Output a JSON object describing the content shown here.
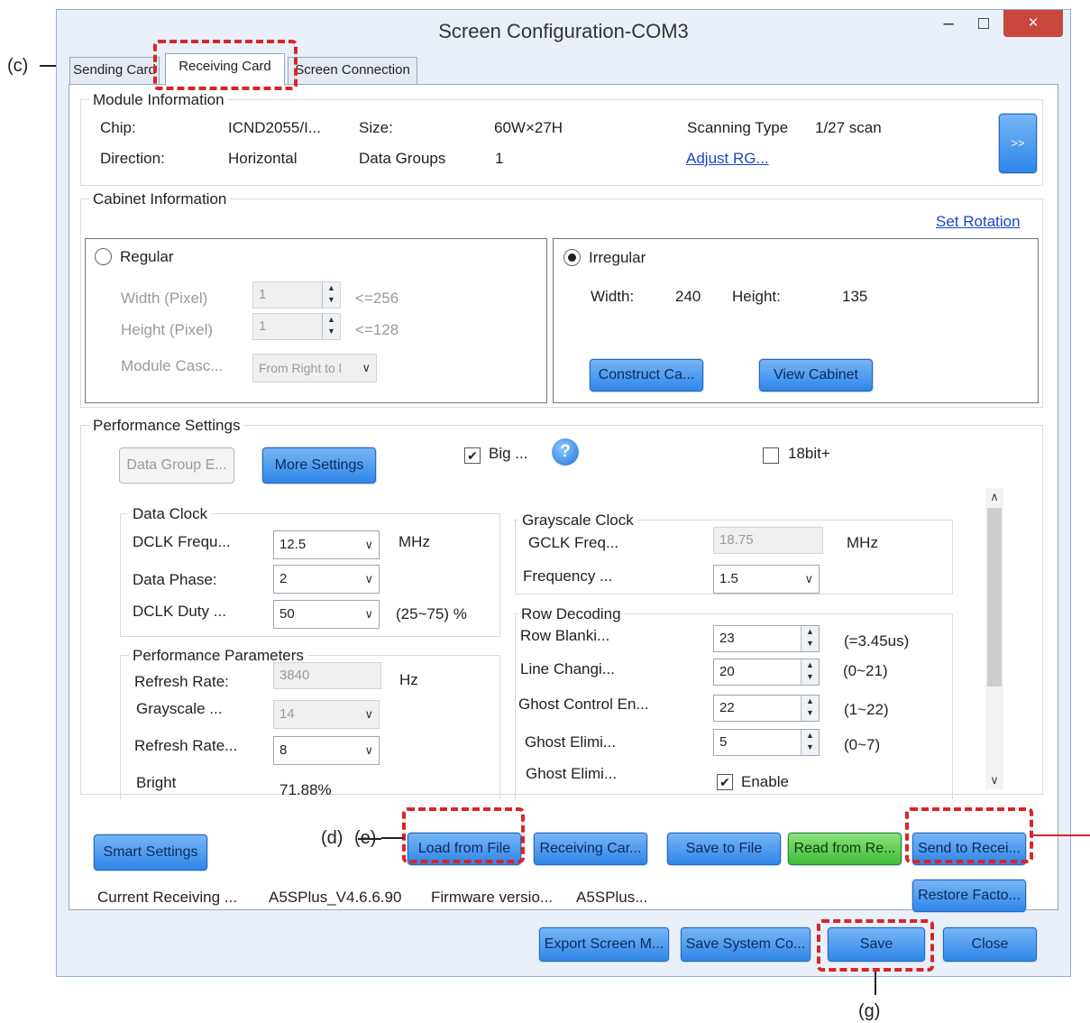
{
  "window": {
    "title": "Screen Configuration-COM3",
    "minimize": "–",
    "maximize": "□",
    "close": "×"
  },
  "tabs": [
    "Sending Card",
    "Receiving Card",
    "Screen Connection"
  ],
  "module": {
    "legend": "Module Information",
    "chip_label": "Chip:",
    "chip_value": "ICND2055/I...",
    "size_label": "Size:",
    "size_value": "60W×27H",
    "scan_label": "Scanning Type",
    "scan_value": "1/27 scan",
    "direction_label": "Direction:",
    "direction_value": "Horizontal",
    "groups_label": "Data Groups",
    "groups_value": "1",
    "adjust_link": "Adjust RG...",
    "more_button": ">>"
  },
  "cabinet": {
    "legend": "Cabinet Information",
    "set_rotation": "Set Rotation",
    "regular": {
      "label": "Regular",
      "selected": false,
      "width_label": "Width (Pixel)",
      "width_value": "1",
      "width_hint": "<=256",
      "height_label": "Height (Pixel)",
      "height_value": "1",
      "height_hint": "<=128",
      "cascade_label": "Module Casc...",
      "cascade_value": "From Right to l"
    },
    "irregular": {
      "label": "Irregular",
      "selected": true,
      "width_label": "Width:",
      "width_value": "240",
      "height_label": "Height:",
      "height_value": "135",
      "construct_button": "Construct Ca...",
      "view_button": "View Cabinet"
    }
  },
  "performance": {
    "legend": "Performance Settings",
    "data_group_button": "Data Group E...",
    "more_settings_button": "More Settings",
    "big_label": "Big ...",
    "big_checked": true,
    "help": "?",
    "bit18_label": "18bit+",
    "bit18_checked": false,
    "data_clock": {
      "legend": "Data Clock",
      "dclk_label": "DCLK Frequ...",
      "dclk_value": "12.5",
      "dclk_unit": "MHz",
      "phase_label": "Data Phase:",
      "phase_value": "2",
      "duty_label": "DCLK Duty ...",
      "duty_value": "50",
      "duty_hint": "(25~75) %"
    },
    "grayscale_clock": {
      "legend": "Grayscale Clock",
      "gclk_label": "GCLK Freq...",
      "gclk_value": "18.75",
      "gclk_unit": "MHz",
      "freq_label": "Frequency ...",
      "freq_value": "1.5"
    },
    "perf_params": {
      "legend": "Performance Parameters",
      "refresh_label": "Refresh Rate:",
      "refresh_value": "3840",
      "refresh_unit": "Hz",
      "grayscale_label": "Grayscale ...",
      "grayscale_value": "14",
      "refresh_mult_label": "Refresh Rate...",
      "refresh_mult_value": "8",
      "bright_label": "Bright",
      "bright_value": "71.88%"
    },
    "row_decoding": {
      "legend": "Row Decoding",
      "rows": [
        {
          "label": "Row Blanki...",
          "value": "23",
          "hint": "(=3.45us)"
        },
        {
          "label": "Line Changi...",
          "value": "20",
          "hint": "(0~21)"
        },
        {
          "label": "Ghost Control En...",
          "value": "22",
          "hint": "(1~22)"
        },
        {
          "label": "Ghost Elimi...",
          "value": "5",
          "hint": "(0~7)"
        }
      ],
      "ghost2_label": "Ghost Elimi...",
      "enable_label": "Enable",
      "enable_checked": true
    }
  },
  "actions": {
    "smart_settings": "Smart Settings",
    "load_from_file": "Load from File",
    "receiving_card": "Receiving Car...",
    "save_to_file": "Save to File",
    "read_from": "Read from Re...",
    "send_to": "Send to Recei...",
    "restore": "Restore Facto...",
    "current_label": "Current Receiving ...",
    "current_value": "A5SPlus_V4.6.6.90",
    "firmware_label": "Firmware versio...",
    "firmware_value": "A5SPlus..."
  },
  "footer": {
    "export": "Export Screen M...",
    "save_system": "Save System Co...",
    "save": "Save",
    "close": "Close"
  },
  "annotations": {
    "c": "(c)",
    "d": "(d)",
    "e": "(e)",
    "g": "(g)"
  }
}
